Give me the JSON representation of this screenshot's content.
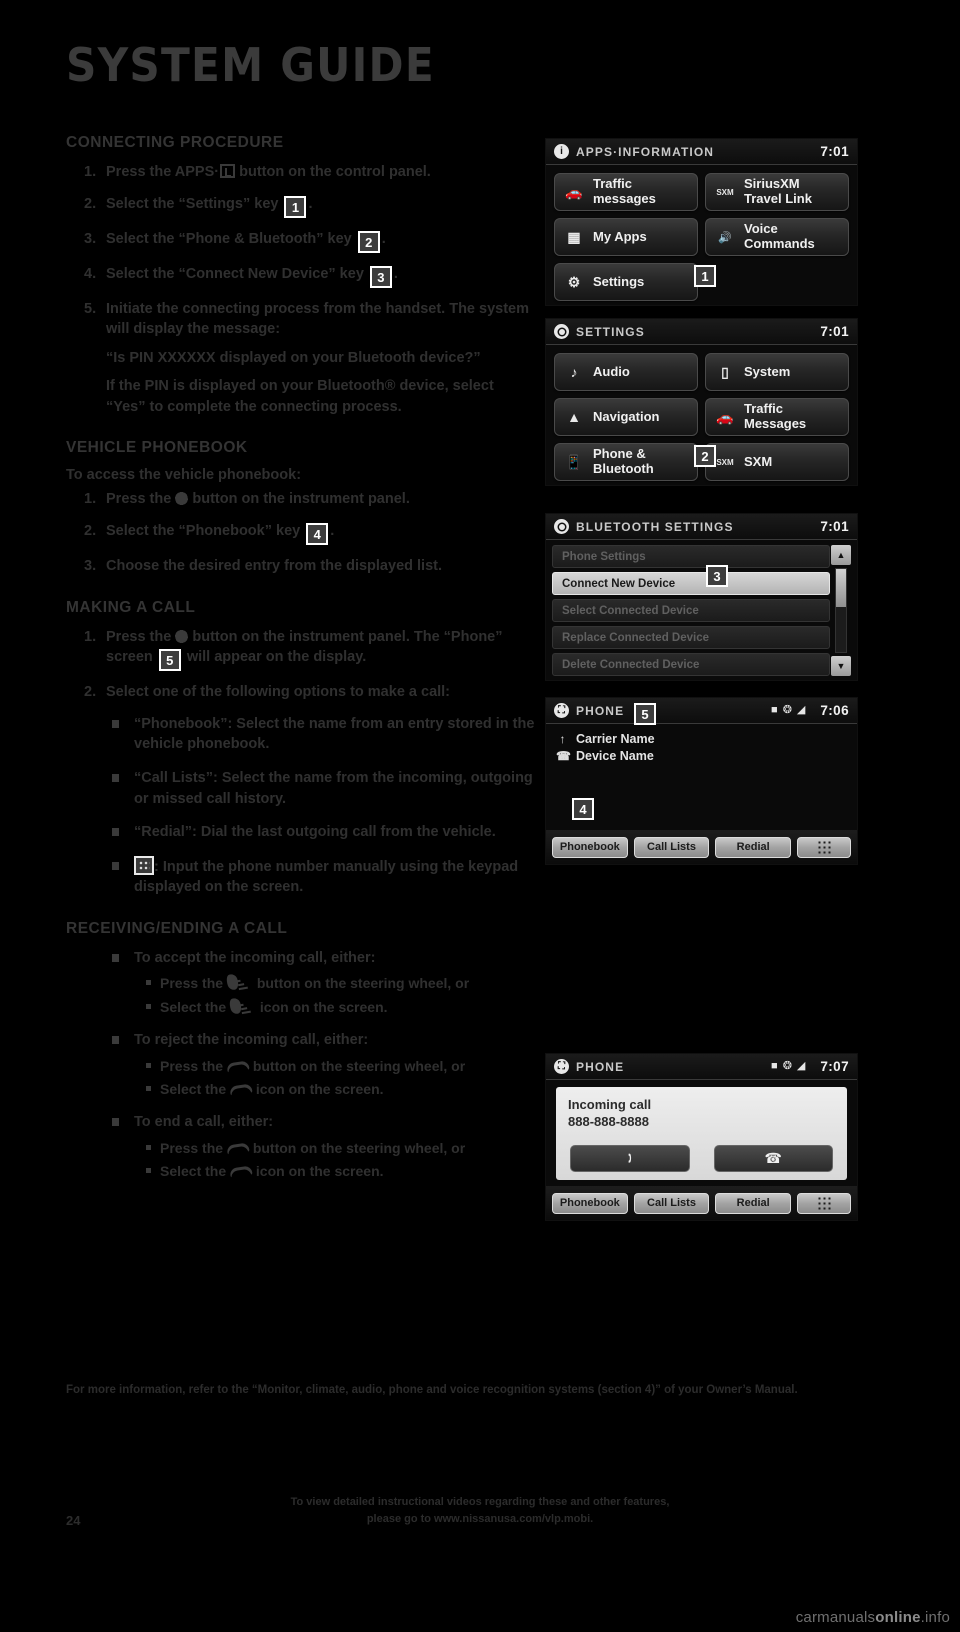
{
  "page": {
    "title": "SYSTEM GUIDE",
    "number": "24",
    "watermark_plain": "carmanuals",
    "watermark_bold": "online",
    "watermark_tld": ".info"
  },
  "sections": {
    "connecting": {
      "heading": "CONNECTING PROCEDURE",
      "steps": [
        {
          "num": "1.",
          "pre": "Press the ",
          "bold": "APPS·",
          "post": " button on the control panel.",
          "icon": "apps-box-icon"
        },
        {
          "num": "2.",
          "pre": "Select the “Settings” key ",
          "chip": "1",
          "post": "."
        },
        {
          "num": "3.",
          "pre": "Select the “Phone & Bluetooth” key ",
          "chip": "2",
          "post": "."
        },
        {
          "num": "4.",
          "pre": "Select the “Connect New Device” key ",
          "chip": "3",
          "post": "."
        },
        {
          "num": "5.",
          "pre": "Initiate the connecting process from the handset. The system will display the message:",
          "quote": "“Is PIN XXXXXX displayed on your Bluetooth device?”",
          "tail": "If the PIN is displayed on your Bluetooth® device, select “Yes” to complete the connecting process."
        }
      ]
    },
    "phonebook": {
      "heading": "VEHICLE PHONEBOOK",
      "lead": "To access the vehicle phonebook:",
      "steps": [
        {
          "num": "1.",
          "pre": "Press the ",
          "post": " button on the instrument panel.",
          "icon": "phone-hook-icon"
        },
        {
          "num": "2.",
          "pre": "Select the “Phonebook” key ",
          "chip": "4",
          "post": "."
        },
        {
          "num": "3.",
          "pre": "Choose the desired entry from the displayed list."
        }
      ]
    },
    "making_call": {
      "heading": "MAKING A CALL",
      "steps": [
        {
          "num": "1.",
          "pre": "Press the ",
          "mid": " button on the instrument panel. The “Phone” screen ",
          "chip": "5",
          "post": " will appear on the display.",
          "icon": "phone-hook-icon"
        },
        {
          "num": "2.",
          "pre": "Select one of the following options to make a call:"
        }
      ],
      "options": [
        "“Phonebook”: Select the name from an entry stored in the vehicle phonebook.",
        "“Call Lists”: Select the name from the incoming, outgoing or missed call history.",
        "“Redial”: Dial the last outgoing call from the vehicle.",
        ": Input the phone number manually using the keypad displayed on the screen."
      ]
    },
    "receiving": {
      "heading": "RECEIVING/ENDING A CALL",
      "groups": [
        {
          "label": "To accept the incoming call, either:",
          "icon": "accept-call-icon",
          "subs": [
            {
              "pre": "Press the ",
              "post": " button on the steering wheel, or"
            },
            {
              "pre": "Select the ",
              "post": " icon on the screen."
            }
          ]
        },
        {
          "label": "To reject the incoming call, either:",
          "icon": "end-call-icon",
          "subs": [
            {
              "pre": "Press the ",
              "post": " button on the steering wheel, or"
            },
            {
              "pre": "Select the ",
              "post": " icon on the screen."
            }
          ]
        },
        {
          "label": "To end a call, either:",
          "icon": "end-call-icon",
          "subs": [
            {
              "pre": "Press the ",
              "post": " button on the steering wheel, or"
            },
            {
              "pre": "Select the ",
              "post": " icon on the screen."
            }
          ]
        }
      ]
    }
  },
  "note": "For more information, refer to the “Monitor, climate, audio, phone and voice recognition systems (section 4)” of your Owner’s Manual.",
  "footer": {
    "line1": "To view detailed instructional videos regarding these and other features,",
    "line2": "please go to www.nissanusa.com/vlp.mobi."
  },
  "screens": {
    "apps_information": {
      "header_title": "APPS·INFORMATION",
      "clock": "7:01",
      "header_icon": "info-icon",
      "tiles": [
        {
          "label": "Traffic messages",
          "icon": "traffic-car-icon"
        },
        {
          "label": "SiriusXM Travel Link",
          "icon": "sxm-icon"
        },
        {
          "label": "My Apps",
          "icon": "apps-grid-icon"
        },
        {
          "label": "Voice Commands",
          "icon": "voice-icon"
        },
        {
          "label": "Settings",
          "icon": "gear-icon"
        }
      ],
      "callout": "1"
    },
    "settings": {
      "header_title": "SETTINGS",
      "clock": "7:01",
      "header_icon": "gear-icon",
      "tiles": [
        {
          "label": "Audio",
          "icon": "music-note-icon"
        },
        {
          "label": "System",
          "icon": "display-icon"
        },
        {
          "label": "Navigation",
          "icon": "nav-arrow-icon"
        },
        {
          "label": "Traffic Messages",
          "icon": "traffic-car-icon"
        },
        {
          "label": "Phone & Bluetooth",
          "icon": "mobile-phone-icon"
        },
        {
          "label": "SXM",
          "icon": "sxm-icon"
        }
      ],
      "callout": "2"
    },
    "bluetooth_settings": {
      "header_title": "BLUETOOTH SETTINGS",
      "clock": "7:01",
      "header_icon": "gear-icon",
      "rows": [
        {
          "label": "Phone Settings",
          "selected": false
        },
        {
          "label": "Connect New Device",
          "selected": true
        },
        {
          "label": "Select Connected Device",
          "selected": false
        },
        {
          "label": "Replace Connected Device",
          "selected": false
        },
        {
          "label": "Delete Connected Device",
          "selected": false
        }
      ],
      "scroll_up": "▲",
      "scroll_down": "▼",
      "callout": "3"
    },
    "phone": {
      "header_title": "PHONE",
      "clock": "7:06",
      "header_icon": "mobile-phone-icon",
      "status_icons": [
        "battery-icon",
        "bluetooth-icon",
        "signal-icon"
      ],
      "lines": [
        {
          "text": "Carrier Name",
          "icon": "signal-icon"
        },
        {
          "text": "Device Name",
          "icon": "handset-icon"
        }
      ],
      "soft_buttons": [
        "Phonebook",
        "Call Lists",
        "Redial"
      ],
      "keypad_button": "keypad-icon",
      "callout_screen": "5",
      "callout_buttons": "4"
    },
    "incoming": {
      "header_title": "PHONE",
      "clock": "7:07",
      "header_icon": "mobile-phone-icon",
      "status_icons": [
        "battery-icon",
        "bluetooth-icon",
        "signal-icon"
      ],
      "dialog_title": "Incoming call",
      "dialog_number": "888-888-8888",
      "accept_icon": "accept-call-icon",
      "reject_icon": "end-call-icon",
      "soft_buttons": [
        "Phonebook",
        "Call Lists",
        "Redial"
      ],
      "keypad_button": "keypad-icon"
    }
  }
}
